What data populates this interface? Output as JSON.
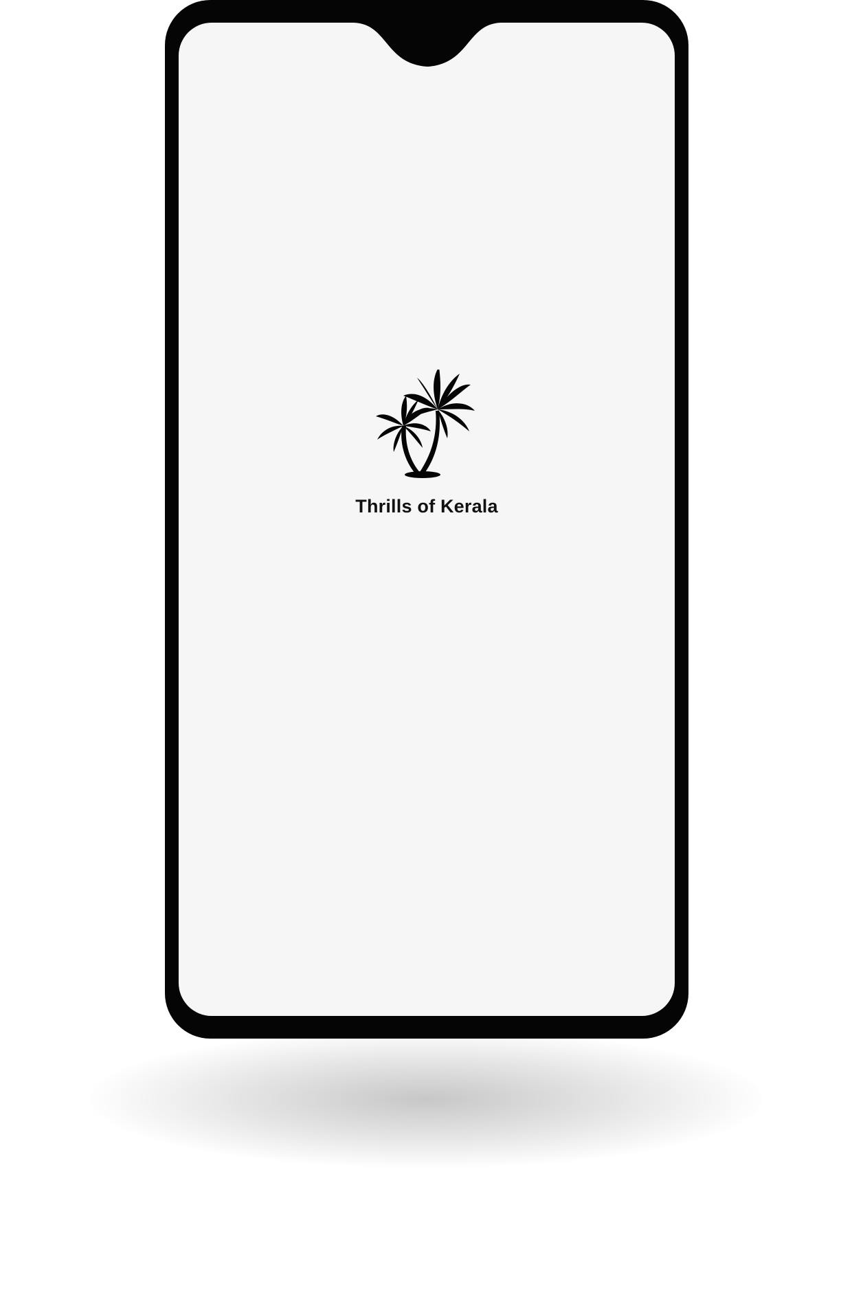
{
  "device": {
    "frame_color": "#050505",
    "screen_color": "#f6f6f6"
  },
  "splash": {
    "logo_icon": "palm-trees-icon",
    "title": "Thrills of Kerala"
  }
}
